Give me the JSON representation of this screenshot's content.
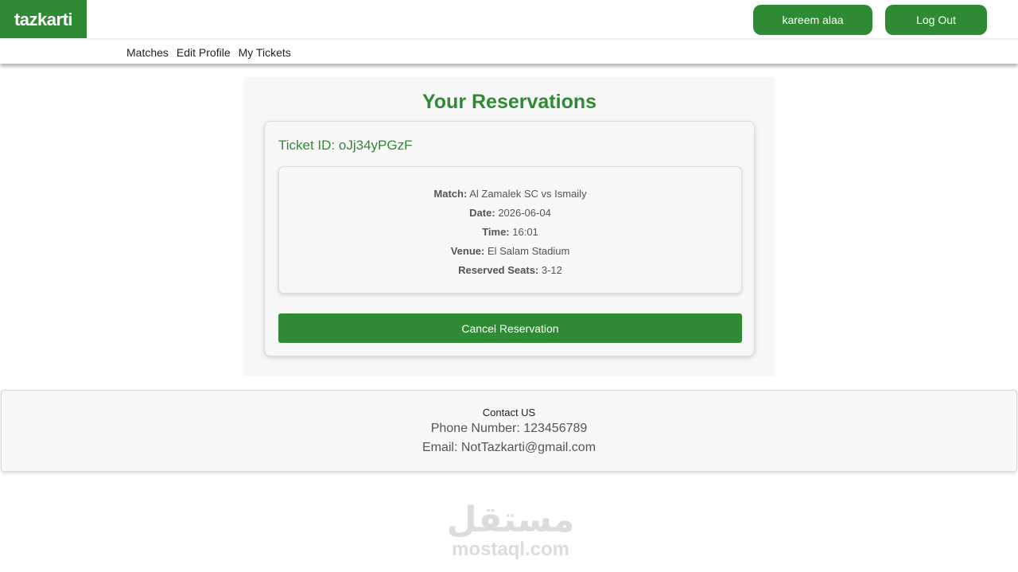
{
  "header": {
    "logo": "tazkarti",
    "user_name": "kareem alaa",
    "logout_label": "Log Out"
  },
  "nav": {
    "items": [
      "Matches",
      "Edit Profile",
      "My Tickets"
    ]
  },
  "reservations": {
    "title": "Your Reservations",
    "ticket": {
      "id_label": "Ticket ID:",
      "id_value": "oJj34yPGzF",
      "match_label": "Match:",
      "match_value": "Al Zamalek SC vs Ismaily",
      "date_label": "Date:",
      "date_value": "2026-06-04",
      "time_label": "Time:",
      "time_value": "16:01",
      "venue_label": "Venue:",
      "venue_value": "El Salam Stadium",
      "seats_label": "Reserved Seats:",
      "seats_value": "3-12",
      "cancel_label": "Cancel Reservation"
    }
  },
  "footer": {
    "title": "Contact US",
    "phone": "Phone Number: 123456789",
    "email": "Email: NotTazkarti@gmail.com"
  },
  "watermark": {
    "arabic": "مستقل",
    "latin": "mostaql.com"
  },
  "colors": {
    "accent": "#2e8b33",
    "panel_bg": "#f7f7f7"
  }
}
